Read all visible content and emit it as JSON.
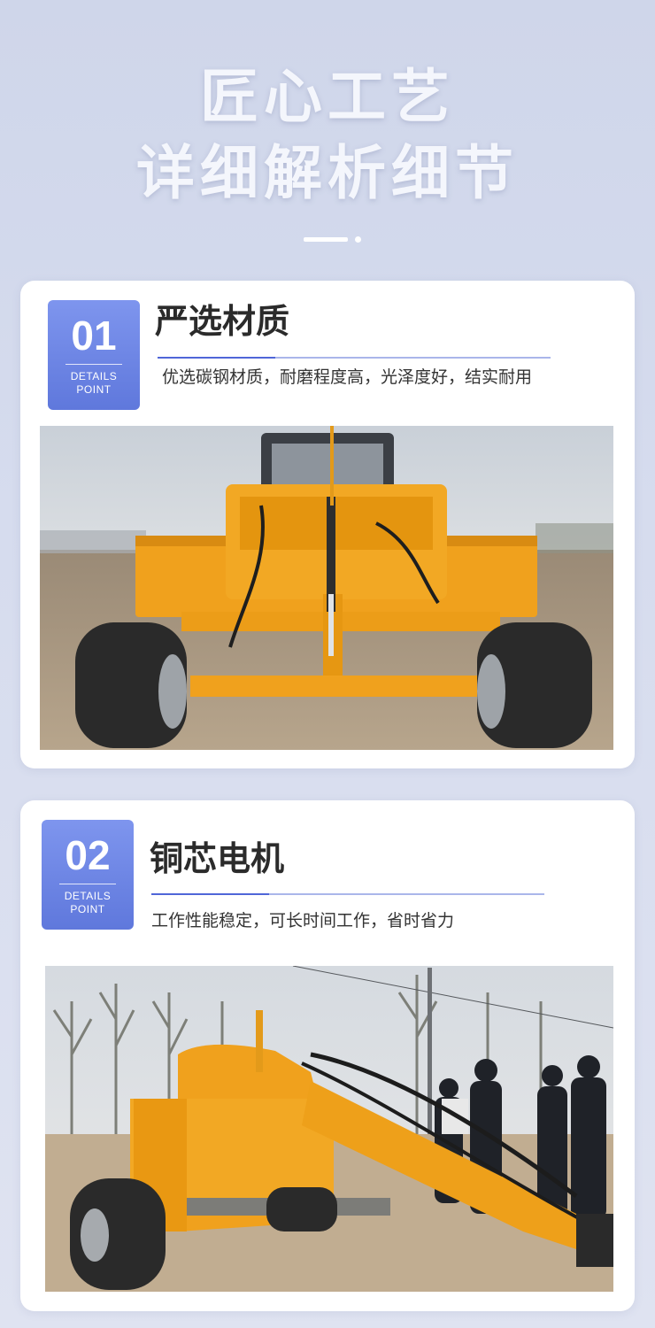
{
  "hero": {
    "line1": "匠心工艺",
    "line2": "详细解析细节"
  },
  "features": [
    {
      "number": "01",
      "badge_line1": "DETAILS",
      "badge_line2": "POINT",
      "title": "严选材质",
      "description": "优选碳钢材质，耐磨程度高，光泽度好，结实耐用"
    },
    {
      "number": "02",
      "badge_line1": "DETAILS",
      "badge_line2": "POINT",
      "title": "铜芯电机",
      "description": "工作性能稳定，可长时间工作，省时省力"
    }
  ],
  "colors": {
    "accent": "#5f78dc",
    "machine_orange": "#f0a11d",
    "background": "#d6dcee"
  }
}
